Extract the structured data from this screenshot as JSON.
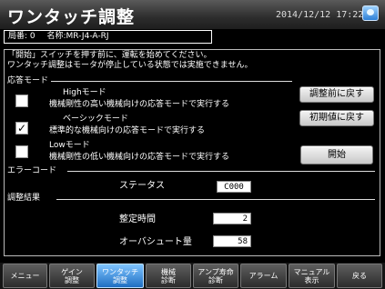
{
  "header": {
    "title": "ワンタッチ調整",
    "datetime": "2014/12/12  17:22"
  },
  "station": {
    "number_label": "局番: 0",
    "model_label": "名称:MR-J4-A-RJ"
  },
  "message": {
    "line1": "「開始」スイッチを押す前に、運転を始めてください。",
    "line2": "ワンタッチ調整はモータが停止している状態では実施できません。"
  },
  "response_mode": {
    "section_label": "応答モード",
    "modes": [
      {
        "name": "Highモード",
        "desc": "機械剛性の高い機械向けの応答モードで実行する",
        "checked": false,
        "mark": ""
      },
      {
        "name": "ベーシックモード",
        "desc": "標準的な機械向けの応答モードで実行する",
        "checked": true,
        "mark": "✓"
      },
      {
        "name": "Lowモード",
        "desc": "機械剛性の低い機械向けの応答モードで実行する",
        "checked": false,
        "mark": ""
      }
    ],
    "buttons": {
      "revert_label": "調整前に戻す",
      "initial_label": "初期値に戻す",
      "start_label": "開始"
    }
  },
  "error_code": {
    "section_label": "エラーコード",
    "status_label": "ステータス",
    "status_value": "C000"
  },
  "result": {
    "section_label": "調整結果",
    "settle_time_label": "整定時間",
    "settle_time_value": "2",
    "overshoot_label": "オーバシュート量",
    "overshoot_value": "58"
  },
  "nav": {
    "items": [
      {
        "label": "メニュー",
        "active": false
      },
      {
        "label": "ゲイン\n調整",
        "active": false
      },
      {
        "label": "ワンタッチ\n調整",
        "active": true
      },
      {
        "label": "機械\n診断",
        "active": false
      },
      {
        "label": "アンプ寿命\n診断",
        "active": false
      },
      {
        "label": "アラーム",
        "active": false
      },
      {
        "label": "マニュアル\n表示",
        "active": false
      },
      {
        "label": "戻る",
        "active": false
      }
    ]
  },
  "colors": {
    "active_tab": "#3c91e6",
    "background": "#000000"
  }
}
